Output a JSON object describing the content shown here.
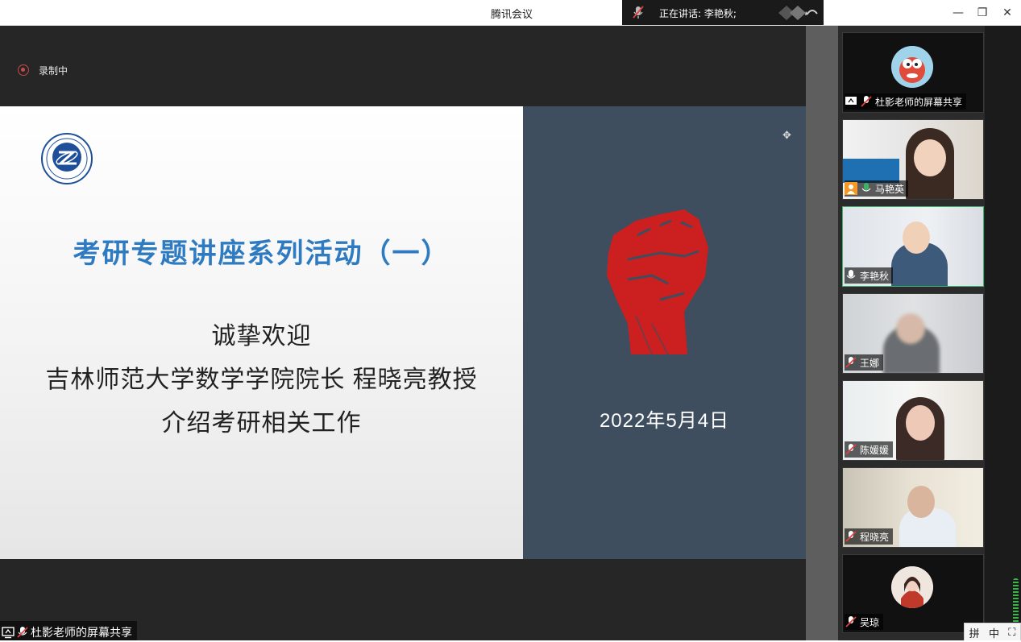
{
  "window": {
    "title": "腾讯会议",
    "minimize_label": "—",
    "restore_label": "❐",
    "close_label": "✕"
  },
  "speaking": {
    "text": "正在讲话: 李艳秋;"
  },
  "recording": {
    "label": "录制中"
  },
  "slide": {
    "title": "考研专题讲座系列活动（一）",
    "line1": "诚挚欢迎",
    "line2": "吉林师范大学数学学院院长 程晓亮教授",
    "line3": "介绍考研相关工作",
    "date": "2022年5月4日",
    "logo_text": "吉林师范大学数学学院",
    "colors": {
      "title": "#2f7bc2",
      "right_panel": "#3f4e5f",
      "fist": "#cc1f1f"
    }
  },
  "share_bar": {
    "label": "杜影老师的屏幕共享"
  },
  "participants": [
    {
      "name": "杜影老师的屏幕共享",
      "kind": "avatar",
      "status_icon": "screen-share-icon",
      "mic": "muted"
    },
    {
      "name": "马艳英",
      "kind": "video",
      "status_icon": "person-icon",
      "mic": "on"
    },
    {
      "name": "李艳秋",
      "kind": "video",
      "status_icon": "",
      "mic": "on",
      "speaking": true
    },
    {
      "name": "王娜",
      "kind": "video",
      "status_icon": "",
      "mic": "muted"
    },
    {
      "name": "陈媛媛",
      "kind": "video",
      "status_icon": "",
      "mic": "muted"
    },
    {
      "name": "程晓亮",
      "kind": "video",
      "status_icon": "",
      "mic": "muted"
    },
    {
      "name": "吴琼",
      "kind": "avatar",
      "status_icon": "",
      "mic": "muted"
    }
  ],
  "ime": {
    "mode": "拼",
    "punct": "中",
    "extra": "⛶"
  }
}
